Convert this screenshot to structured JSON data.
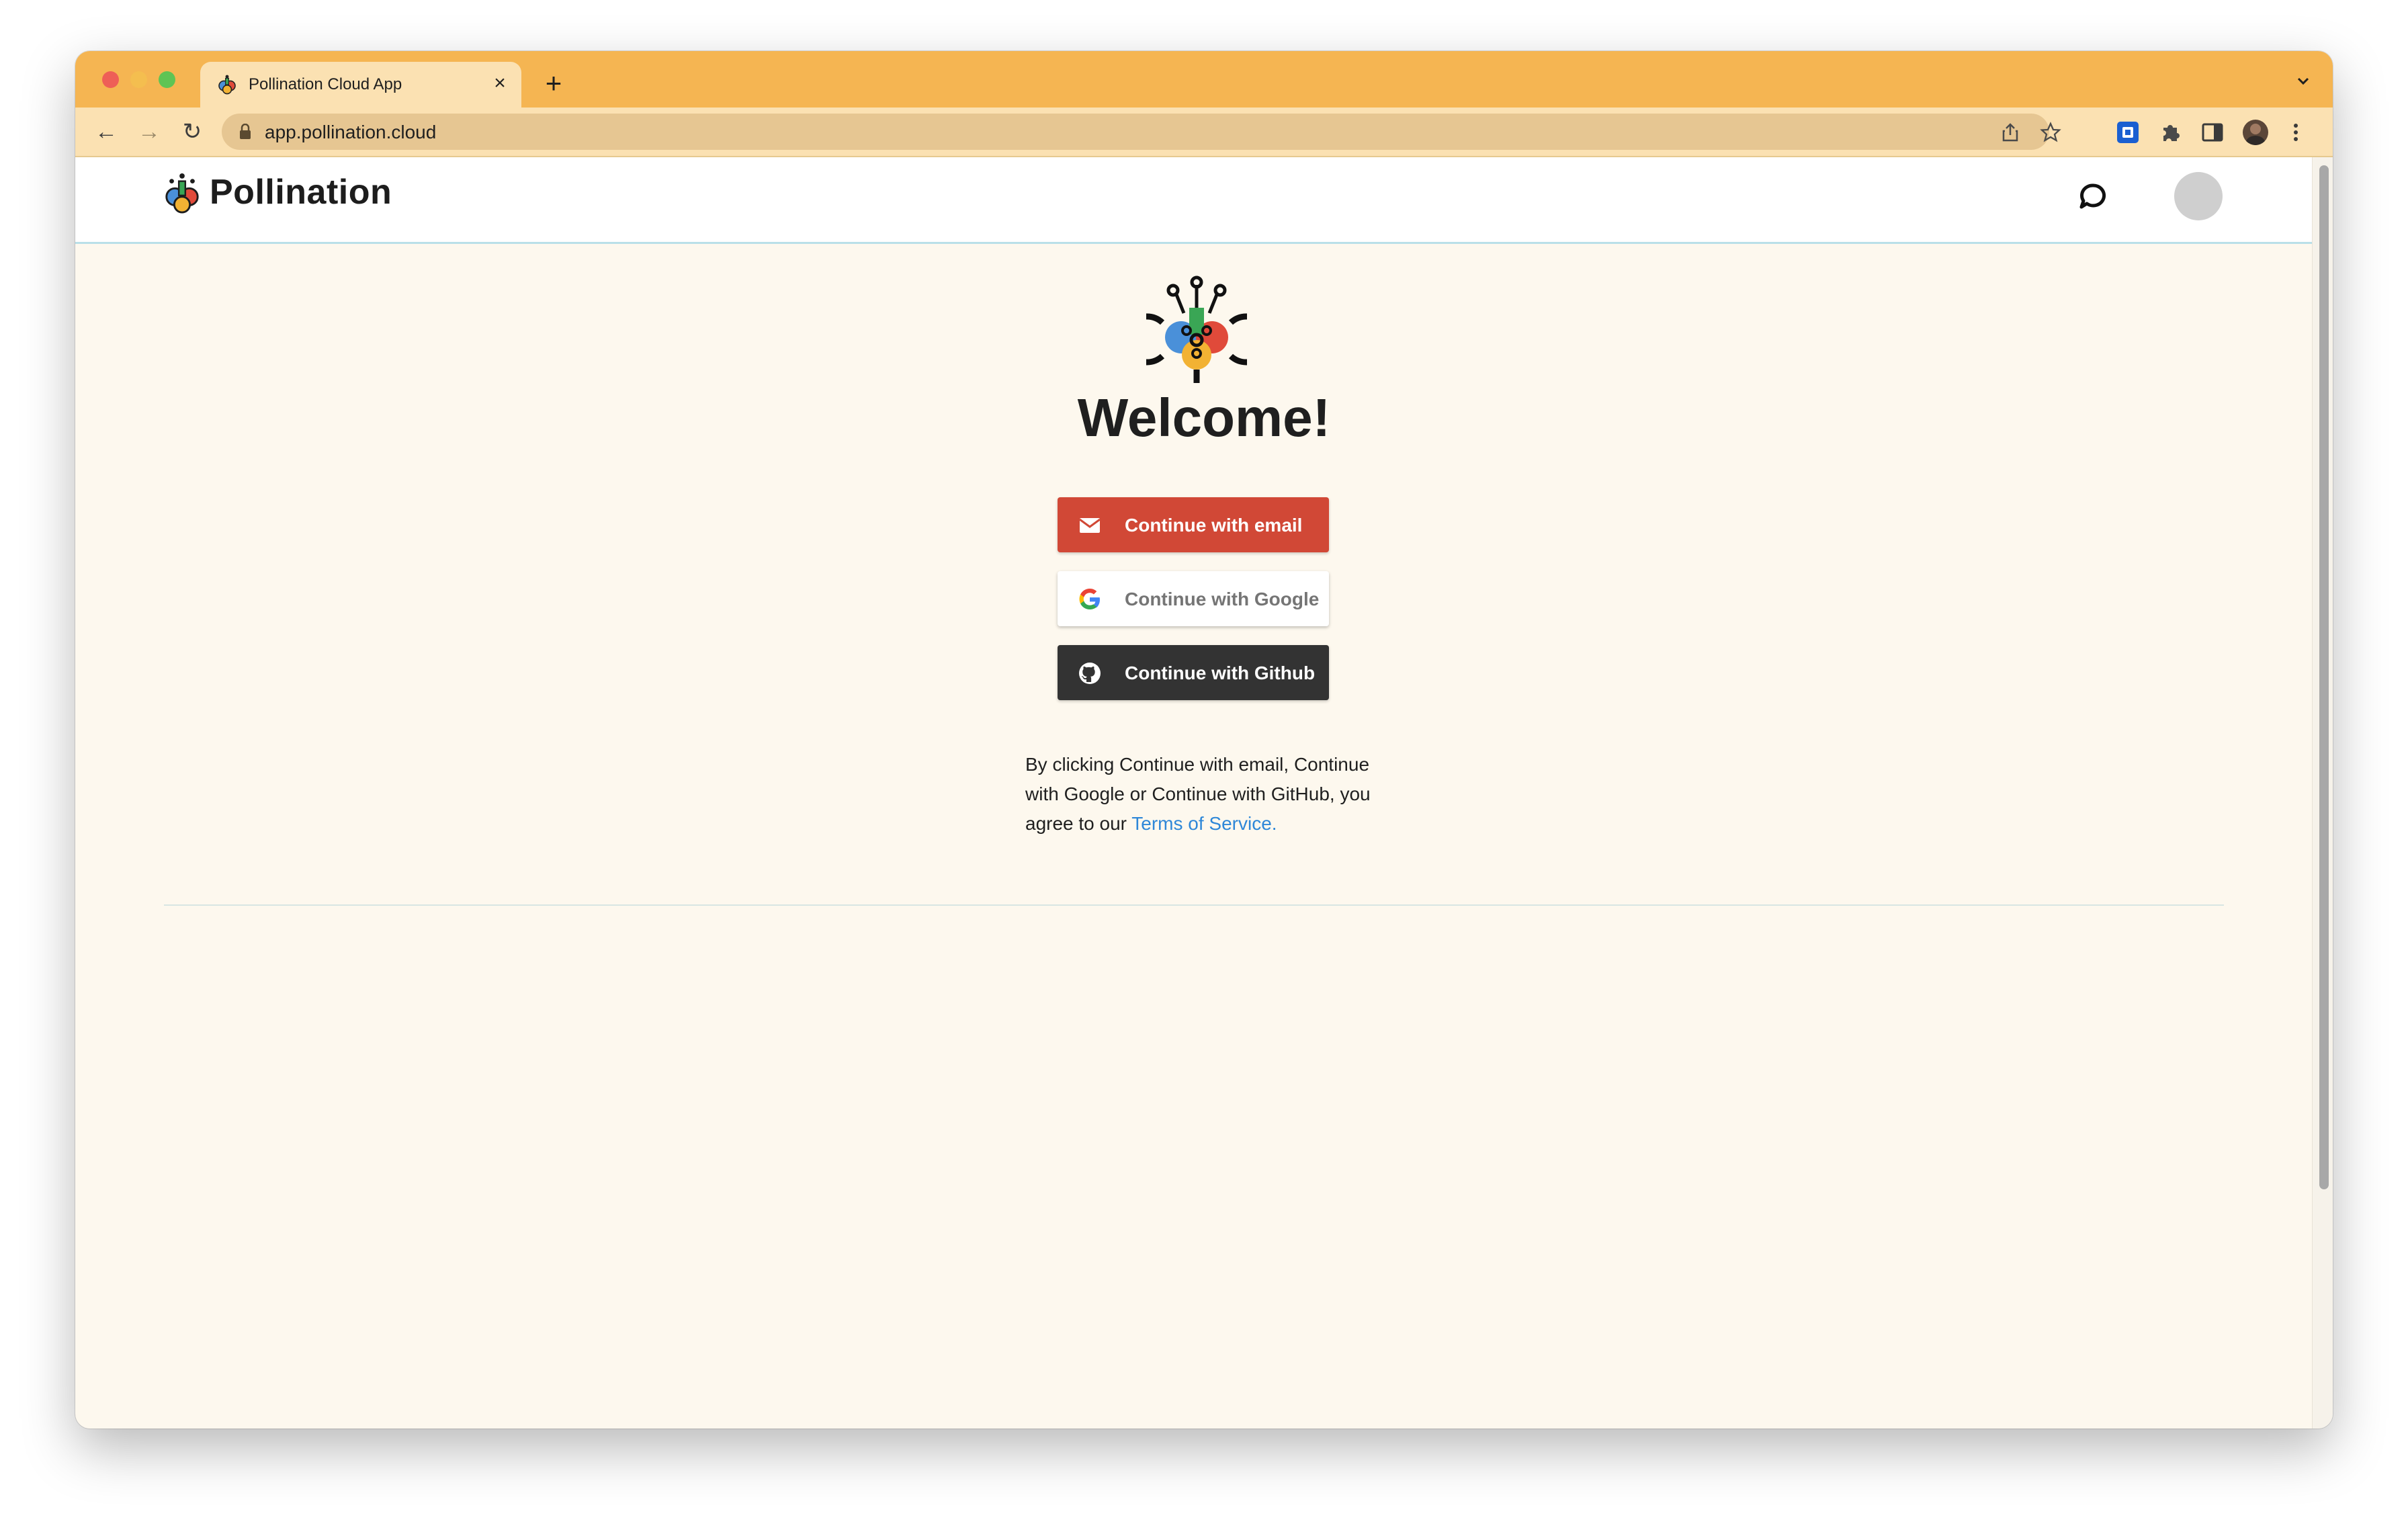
{
  "browser": {
    "tab_title": "Pollination Cloud App",
    "tab_close": "×",
    "new_tab": "+",
    "tab_list": "⌄",
    "url": "app.pollination.cloud",
    "nav_back": "←",
    "nav_forward": "→",
    "nav_reload": "↻"
  },
  "header": {
    "brand_name": "Pollination"
  },
  "main": {
    "welcome": "Welcome!",
    "buttons": {
      "email": "Continue with email",
      "google": "Continue with Google",
      "github": "Continue with Github"
    },
    "legal": {
      "text": "By clicking Continue with email, Continue with Google or Continue with GitHub, you agree to our ",
      "link": "Terms of Service."
    }
  },
  "colors": {
    "tabbar": "#f5b552",
    "toolbar": "#fbe1b2",
    "page_bg": "#fdf8ee",
    "email_btn": "#d14836",
    "github_btn": "#333333",
    "link": "#2e87d8"
  },
  "icons": [
    "pollination-logo-icon",
    "lock-icon",
    "share-icon",
    "star-icon",
    "extension-icon",
    "puzzle-icon",
    "sidepanel-icon",
    "profile-icon",
    "menu-kebab-icon",
    "chat-icon",
    "email-icon",
    "google-icon",
    "github-icon"
  ]
}
